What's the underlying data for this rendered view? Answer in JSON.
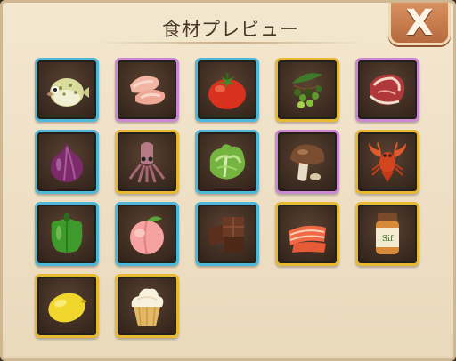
{
  "dialog": {
    "title": "食材プレビュー",
    "close_label": "X"
  },
  "colors": {
    "rarity_blue": "#4fb7d8",
    "rarity_purple": "#cc88d3",
    "rarity_gold": "#e9b833"
  },
  "ingredients": [
    {
      "icon": "pufferfish-icon",
      "rarity": "blue"
    },
    {
      "icon": "chicken-icon",
      "rarity": "purple"
    },
    {
      "icon": "tomato-icon",
      "rarity": "blue"
    },
    {
      "icon": "peppercorn-icon",
      "rarity": "gold"
    },
    {
      "icon": "steak-icon",
      "rarity": "purple"
    },
    {
      "icon": "onion-icon",
      "rarity": "blue"
    },
    {
      "icon": "squid-icon",
      "rarity": "gold"
    },
    {
      "icon": "lettuce-icon",
      "rarity": "blue"
    },
    {
      "icon": "mushroom-icon",
      "rarity": "purple"
    },
    {
      "icon": "lobster-icon",
      "rarity": "gold"
    },
    {
      "icon": "green-pepper-icon",
      "rarity": "blue"
    },
    {
      "icon": "peach-icon",
      "rarity": "blue"
    },
    {
      "icon": "chocolate-icon",
      "rarity": "blue"
    },
    {
      "icon": "salmon-icon",
      "rarity": "gold"
    },
    {
      "icon": "spice-jar-icon",
      "rarity": "gold"
    },
    {
      "icon": "lemon-icon",
      "rarity": "gold"
    },
    {
      "icon": "cupcake-icon",
      "rarity": "gold"
    }
  ],
  "spice_jar_label": "Sif"
}
